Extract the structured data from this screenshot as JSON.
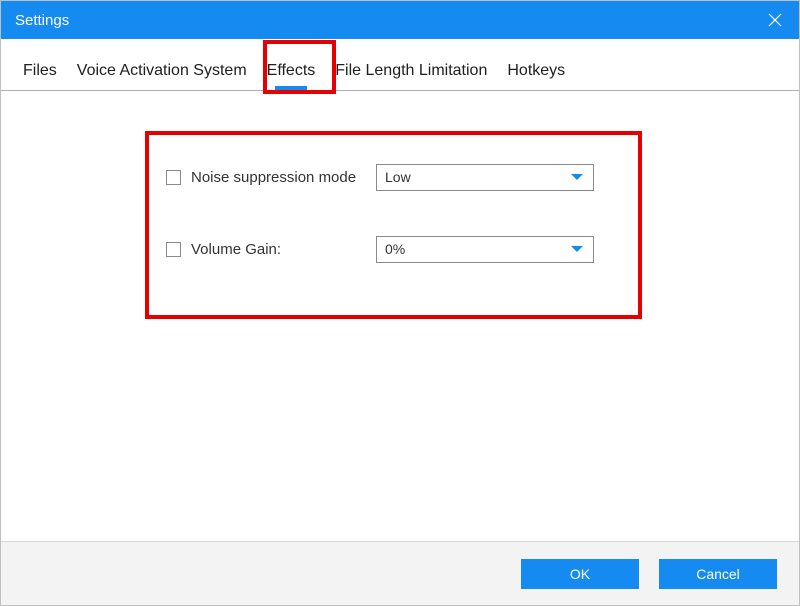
{
  "titlebar": {
    "title": "Settings"
  },
  "tabs": {
    "files": "Files",
    "voice": "Voice Activation System",
    "effects": "Effects",
    "fileLength": "File Length Limitation",
    "hotkeys": "Hotkeys"
  },
  "effects": {
    "noise": {
      "label": "Noise suppression mode",
      "value": "Low"
    },
    "volume": {
      "label": "Volume Gain:",
      "value": "0%"
    }
  },
  "footer": {
    "ok": "OK",
    "cancel": "Cancel"
  }
}
